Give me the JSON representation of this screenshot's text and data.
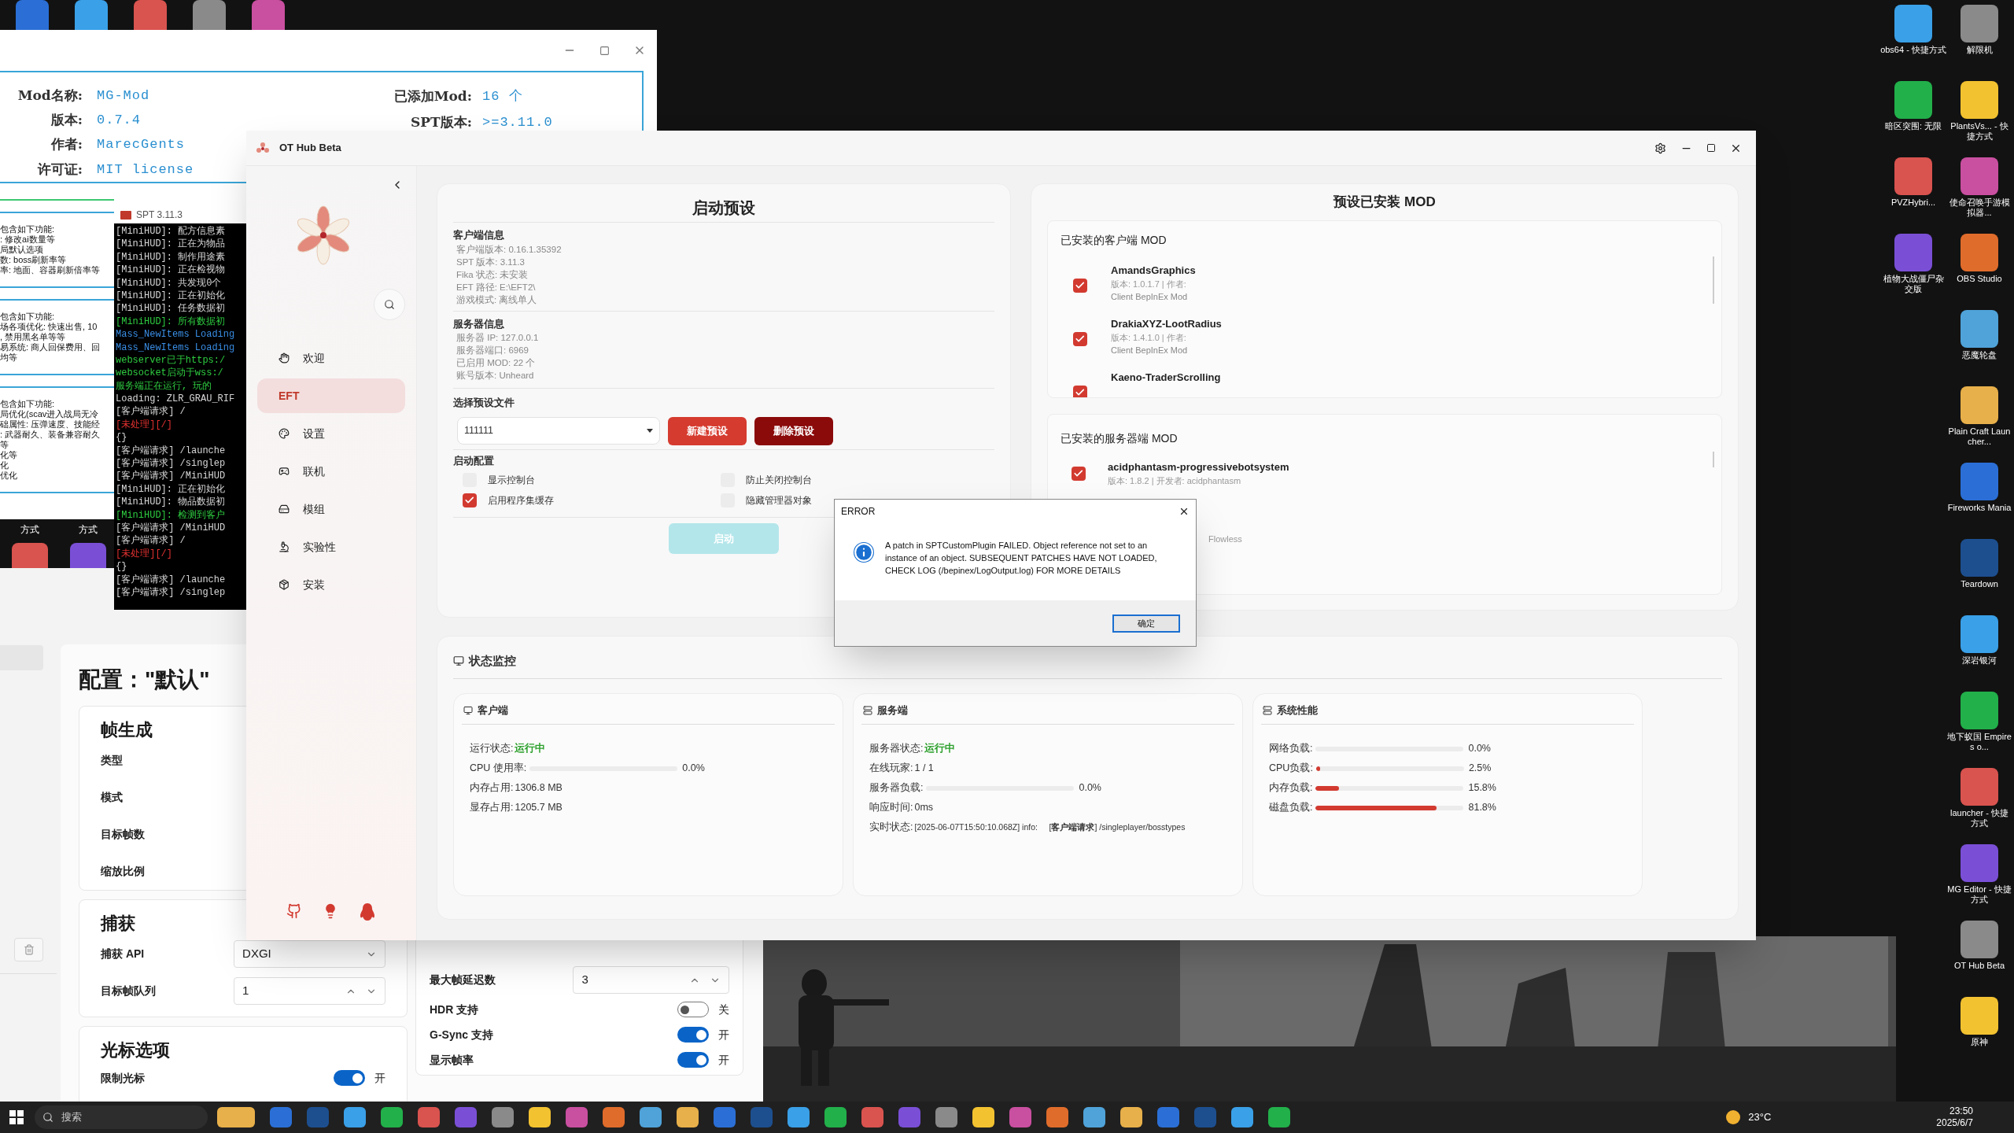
{
  "mod_window": {
    "fields_left": [
      {
        "label": "Mod名称:",
        "value": "MG-Mod"
      },
      {
        "label": "版本:",
        "value": "0.7.4"
      },
      {
        "label": "作者:",
        "value": "MarecGents"
      },
      {
        "label": "许可证:",
        "value": "MIT license"
      }
    ],
    "fields_right": [
      {
        "label": "已添加Mod:",
        "value": "16 个"
      },
      {
        "label": "SPT版本:",
        "value": ">=3.11.0"
      }
    ],
    "sections": [
      [
        "包含如下功能:",
        ": 修改ai数量等",
        "局默认选项",
        "数: boss刷新率等",
        "率: 地面、容器刷新倍率等"
      ],
      [
        "包含如下功能:",
        "场各项优化: 快速出售, 10",
        ", 禁用黑名单等等",
        "易系统: 商人回保费用、回",
        "均等"
      ],
      [
        "包含如下功能:",
        "局优化(scav进入战局无冷",
        "础属性: 压弹速度、技能经",
        ": 武器耐久、装备兼容耐久",
        "等",
        "化等",
        "化",
        "优化"
      ]
    ]
  },
  "desktop_left_labels": [
    "方式",
    "方式"
  ],
  "console": {
    "title": "SPT 3.11.3",
    "lines": [
      {
        "text": "[MiniHUD]: 配方信息素",
        "kind": "white"
      },
      {
        "text": "[MiniHUD]: 正在为物品",
        "kind": "white"
      },
      {
        "text": "[MiniHUD]: 制作用途素",
        "kind": "white"
      },
      {
        "text": "[MiniHUD]: 正在检视物",
        "kind": "white"
      },
      {
        "text": "[MiniHUD]: 共发现0个",
        "kind": "white"
      },
      {
        "text": "[MiniHUD]: 正在初始化",
        "kind": "white"
      },
      {
        "text": "[MiniHUD]: 任务数据初",
        "kind": "white"
      },
      {
        "text": "[MiniHUD]: 所有数据初",
        "kind": "green"
      },
      {
        "text": "Mass_NewItems Loading",
        "kind": "blue"
      },
      {
        "text": "Mass_NewItems Loading",
        "kind": "blue"
      },
      {
        "text": "webserver已于https:/",
        "kind": "green"
      },
      {
        "text": "websocket启动于wss:/",
        "kind": "green"
      },
      {
        "text": "服务端正在运行, 玩的",
        "kind": "green"
      },
      {
        "text": "Loading: ZLR_GRAU_RIF",
        "kind": "white"
      },
      {
        "text": "[客户端请求] /",
        "kind": "white"
      },
      {
        "text": "[未处理][/]",
        "kind": "red"
      },
      {
        "text": "{}",
        "kind": "white"
      },
      {
        "text": "[客户端请求] /launche",
        "kind": "white"
      },
      {
        "text": "[客户端请求] /singlep",
        "kind": "white"
      },
      {
        "text": "[客户端请求] /MiniHUD",
        "kind": "white"
      },
      {
        "text": "[MiniHUD]: 正在初始化",
        "kind": "white"
      },
      {
        "text": "[MiniHUD]: 物品数据初",
        "kind": "white"
      },
      {
        "text": "[MiniHUD]: 检测到客户",
        "kind": "green"
      },
      {
        "text": "[客户端请求] /MiniHUD",
        "kind": "white"
      },
      {
        "text": "[客户端请求] /",
        "kind": "white"
      },
      {
        "text": "[未处理][/]",
        "kind": "red"
      },
      {
        "text": "{}",
        "kind": "white"
      },
      {
        "text": "[客户端请求] /launche",
        "kind": "white"
      },
      {
        "text": "[客户端请求] /singlep",
        "kind": "white"
      }
    ]
  },
  "settings_window": {
    "title": "配置：\"默认\"",
    "sections": [
      {
        "title": "帧生成",
        "rows": [
          {
            "label": "类型",
            "kind": "label"
          },
          {
            "label": "模式",
            "kind": "label"
          },
          {
            "label": "目标帧数",
            "kind": "label"
          },
          {
            "label": "缩放比例",
            "kind": "label"
          }
        ]
      },
      {
        "title": "捕获",
        "rows": [
          {
            "label": "捕获 API",
            "kind": "select",
            "value": "DXGI"
          },
          {
            "label": "目标帧队列",
            "kind": "spinner",
            "value": "1"
          }
        ]
      },
      {
        "title": "光标选项",
        "rows": [
          {
            "label": "限制光标",
            "kind": "toggle",
            "on": true,
            "state_label": "开"
          }
        ]
      }
    ],
    "right_rows": [
      {
        "label": "最大帧延迟数",
        "kind": "spinner",
        "value": "3"
      },
      {
        "label": "HDR 支持",
        "kind": "toggle",
        "on": false,
        "state_label": "关"
      },
      {
        "label": "G-Sync 支持",
        "kind": "toggle",
        "on": true,
        "state_label": "开"
      },
      {
        "label": "显示帧率",
        "kind": "toggle",
        "on": true,
        "state_label": "开"
      }
    ]
  },
  "app": {
    "title": "OT Hub Beta",
    "nav": [
      {
        "label": "欢迎",
        "selected": false
      },
      {
        "label": "EFT",
        "selected": true
      },
      {
        "label": "设置",
        "selected": false
      },
      {
        "label": "联机",
        "selected": false
      },
      {
        "label": "模组",
        "selected": false
      },
      {
        "label": "实验性",
        "selected": false
      },
      {
        "label": "安装",
        "selected": false
      }
    ],
    "preset": {
      "title": "启动预设",
      "client_heading": "客户端信息",
      "client_lines": [
        "客户端版本: 0.16.1.35392",
        "SPT 版本: 3.11.3",
        "Fika 状态: 未安装",
        "EFT 路径: E:\\EFT2\\",
        "游戏模式: 离线单人"
      ],
      "server_heading": "服务器信息",
      "server_lines": [
        "服务器 IP: 127.0.0.1",
        "服务器端口: 6969",
        "已启用 MOD: 22 个",
        "账号版本: Unheard"
      ],
      "select_heading": "选择预设文件",
      "select_value": "111111",
      "new_button": "新建预设",
      "delete_button": "删除预设",
      "options_heading": "启动配置",
      "options": [
        {
          "label": "显示控制台",
          "checked": false
        },
        {
          "label": "防止关闭控制台",
          "checked": false
        },
        {
          "label": "启用程序集缓存",
          "checked": true
        },
        {
          "label": "隐藏管理器对象",
          "checked": false
        }
      ],
      "launch": {
        "label": "启动",
        "disabled": true
      }
    },
    "mods": {
      "title": "预设已安装 MOD",
      "client_heading": "已安装的客户端 MOD",
      "client": [
        {
          "name": "AmandsGraphics",
          "meta": "版本: 1.0.1.7 | 作者:",
          "desc": "Client BepInEx Mod",
          "checked": true
        },
        {
          "name": "DrakiaXYZ-LootRadius",
          "meta": "版本: 1.4.1.0 | 作者:",
          "desc": "Client BepInEx Mod",
          "checked": true
        },
        {
          "name": "Kaeno-TraderScrolling",
          "checked": true
        }
      ],
      "server_heading": "已安装的服务器端 MOD",
      "server": [
        {
          "kind": "mod",
          "name": "acidphantasm-progressivebotsystem",
          "meta": "版本: 1.8.2 | 开发者: acidphantasm",
          "checked": true
        },
        {
          "kind": "fragment",
          "text": "Flowless"
        }
      ]
    },
    "monitor": {
      "title": "状态监控",
      "panels": [
        {
          "title": "客户端",
          "rows": [
            {
              "kind": "status",
              "label": "运行状态:",
              "value": "运行中"
            },
            {
              "kind": "bar",
              "label": "CPU 使用率:",
              "level": 0,
              "value": "0.0%"
            },
            {
              "kind": "text",
              "label": "内存占用:",
              "value": "1306.8 MB"
            },
            {
              "kind": "text",
              "label": "显存占用:",
              "value": "1205.7 MB"
            }
          ]
        },
        {
          "title": "服务端",
          "rows": [
            {
              "kind": "status",
              "label": "服务器状态:",
              "value": "运行中"
            },
            {
              "kind": "text",
              "label": "在线玩家:",
              "value": "1 / 1"
            },
            {
              "kind": "bar",
              "label": "服务器负载:",
              "level": 0,
              "value": "0.0%"
            },
            {
              "kind": "text",
              "label": "响应时间:",
              "value": "0ms"
            },
            {
              "kind": "log",
              "label": "实时状态:",
              "value": "[2025-06-07T15:50:10.068Z] info:     [**客户端请求**] /singleplayer/bosstypes"
            }
          ]
        },
        {
          "title": "系统性能",
          "rows": [
            {
              "kind": "bar",
              "label": "网络负载:",
              "level": 0,
              "value": "0.0%"
            },
            {
              "kind": "bar",
              "label": "CPU负载:",
              "level": 0.025,
              "value": "2.5%"
            },
            {
              "kind": "bar",
              "label": "内存负载:",
              "level": 0.158,
              "value": "15.8%"
            },
            {
              "kind": "bar",
              "label": "磁盘负载:",
              "level": 0.818,
              "value": "81.8%"
            }
          ]
        }
      ]
    }
  },
  "dialog": {
    "title": "ERROR",
    "message": "A patch in SPTCustomPlugin FAILED. Object reference not set to an instance of an object. SUBSEQUENT PATCHES HAVE NOT LOADED, CHECK LOG (/bepinex/LogOutput.log) FOR MORE DETAILS",
    "button": "确定"
  },
  "desktop_icons": {
    "column_1": [
      "obs64 - 快捷方式",
      "暗区突围: 无限",
      "PVZHybri...",
      "植物大战僵尸杂交版"
    ],
    "column_2": [
      "解限机",
      "PlantsVs... - 快捷方式",
      "使命召唤手游模拟器...",
      "OBS Studio",
      "恶魔轮盘",
      "Plain Craft Launcher...",
      "Fireworks Mania",
      "Teardown",
      "深岩银河",
      "地下蚁国 Empires o...",
      "launcher - 快捷方式",
      "MG Editor - 快捷方式",
      "OT Hub Beta",
      "原神"
    ]
  },
  "taskbar": {
    "search_placeholder": "搜索",
    "weather": "23°C",
    "time": "23:50",
    "date": "2025/6/7"
  }
}
